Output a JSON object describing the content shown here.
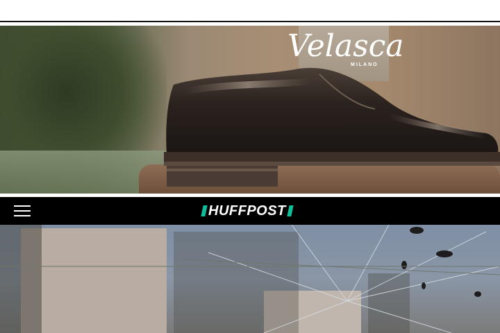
{
  "ad": {
    "brand_name": "Velasca",
    "brand_sub": "MILANO"
  },
  "header": {
    "site_name": "HUFFPOST"
  },
  "icons": {
    "menu": "hamburger-menu-icon"
  },
  "colors": {
    "header_bg": "#000000",
    "huffpost_accent": "#0dbe98"
  }
}
